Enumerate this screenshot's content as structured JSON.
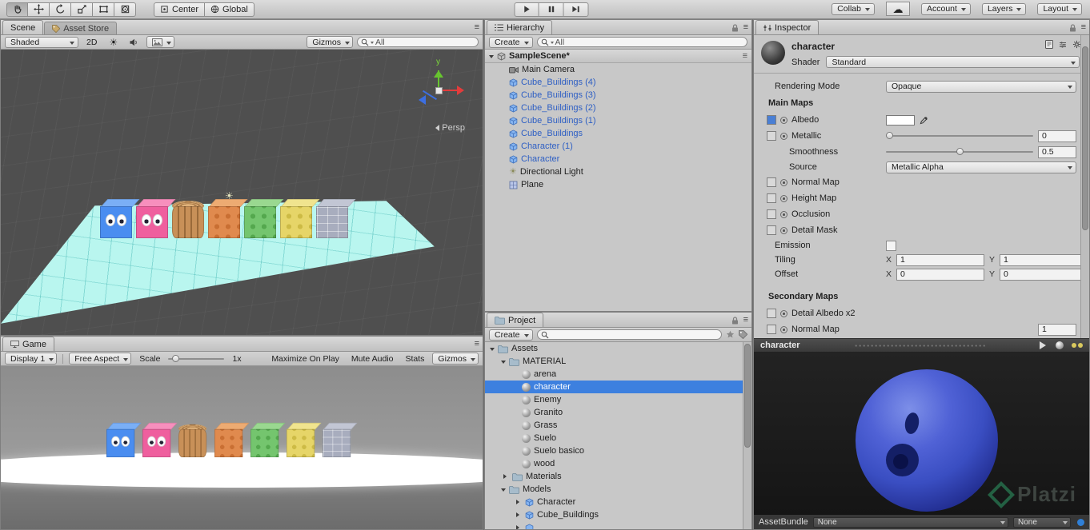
{
  "colors": {
    "selection": "#3d80df",
    "prefab_text": "#2e5fc4",
    "albedo_value": "#ffffff",
    "preview_sphere": "#3a4ec2",
    "plane_cyan": "#b9f6ef",
    "watermark_green": "#2f9e68"
  },
  "icons": {
    "cloud": "☁",
    "sun": "☀",
    "menu": "≡"
  },
  "topbar": {
    "pivot_label": "Center",
    "space_label": "Global",
    "collab_label": "Collab",
    "account_label": "Account",
    "layers_label": "Layers",
    "layout_label": "Layout"
  },
  "scene": {
    "tab_scene": "Scene",
    "tab_asset_store": "Asset Store",
    "shading_mode": "Shaded",
    "btn_2d": "2D",
    "gizmos_label": "Gizmos",
    "search_value": "All",
    "persp_label": "Persp",
    "axis_y_label": "y"
  },
  "game": {
    "tab": "Game",
    "display": "Display 1",
    "aspect": "Free Aspect",
    "scale_label": "Scale",
    "scale_value": "1x",
    "maximize_label": "Maximize On Play",
    "mute_label": "Mute Audio",
    "stats_label": "Stats",
    "gizmos_label": "Gizmos"
  },
  "hierarchy": {
    "tab": "Hierarchy",
    "create_label": "Create",
    "search_value": "All",
    "scene_name": "SampleScene*",
    "items": [
      {
        "label": "Main Camera",
        "type": "camera"
      },
      {
        "label": "Cube_Buildings (4)",
        "type": "prefab"
      },
      {
        "label": "Cube_Buildings (3)",
        "type": "prefab"
      },
      {
        "label": "Cube_Buildings (2)",
        "type": "prefab"
      },
      {
        "label": "Cube_Buildings (1)",
        "type": "prefab"
      },
      {
        "label": "Cube_Buildings",
        "type": "prefab"
      },
      {
        "label": "Character (1)",
        "type": "prefab"
      },
      {
        "label": "Character",
        "type": "prefab"
      },
      {
        "label": "Directional Light",
        "type": "light"
      },
      {
        "label": "Plane",
        "type": "mesh"
      }
    ]
  },
  "project": {
    "tab": "Project",
    "create_label": "Create",
    "root": "Assets",
    "material_folder": "MATERIAL",
    "materials": [
      "arena",
      "character",
      "Enemy",
      "Granito",
      "Grass",
      "Suelo",
      "Suelo basico",
      "wood"
    ],
    "selected_material": "character",
    "folder_materials": "Materials",
    "folder_models": "Models",
    "models": [
      "Character",
      "Cube_Buildings"
    ]
  },
  "inspector": {
    "tab": "Inspector",
    "material_name": "character",
    "shader_label": "Shader",
    "shader_value": "Standard",
    "rendering_mode_label": "Rendering Mode",
    "rendering_mode_value": "Opaque",
    "main_maps": "Main Maps",
    "albedo": "Albedo",
    "metallic": "Metallic",
    "metallic_value": "0",
    "smoothness": "Smoothness",
    "smoothness_value": "0.5",
    "source": "Source",
    "source_value": "Metallic Alpha",
    "normal_map": "Normal Map",
    "height_map": "Height Map",
    "occlusion": "Occlusion",
    "detail_mask": "Detail Mask",
    "emission": "Emission",
    "tiling": "Tiling",
    "offset": "Offset",
    "x_label": "X",
    "y_label": "Y",
    "tiling_x": "1",
    "tiling_y": "1",
    "offset_x": "0",
    "offset_y": "0",
    "secondary_maps": "Secondary Maps",
    "detail_albedo": "Detail Albedo x2",
    "normal_map2": "Normal Map",
    "normal_map2_value": "1",
    "preview_title": "character",
    "assetbundle_label": "AssetBundle",
    "bundle_value": "None",
    "variant_value": "None",
    "watermark": "Platzi"
  },
  "cubes": [
    {
      "name": "character-blue",
      "type": "face",
      "color": "#4a8df0",
      "top": "#7aaff6",
      "accent": "#2f66c4"
    },
    {
      "name": "character-pink",
      "type": "face",
      "color": "#ef5f9e",
      "top": "#f78fbd",
      "accent": "#c23d77"
    },
    {
      "name": "wood-log",
      "type": "wood",
      "color": "#c89058",
      "top": "#e0b27a",
      "accent": "#9a6a3a"
    },
    {
      "name": "orange-dots",
      "type": "dots",
      "color": "#e08a4e",
      "top": "#edab72",
      "accent": "#c96f33"
    },
    {
      "name": "green-dots",
      "type": "dots",
      "color": "#74c56e",
      "top": "#9ad890",
      "accent": "#54a84e"
    },
    {
      "name": "yellow-dots",
      "type": "dots",
      "color": "#e6d568",
      "top": "#f0e48e",
      "accent": "#cdbb45"
    },
    {
      "name": "gray-brick",
      "type": "brick",
      "color": "#a8adbe",
      "top": "#c2c6d4",
      "accent": "#8c92a6"
    }
  ]
}
